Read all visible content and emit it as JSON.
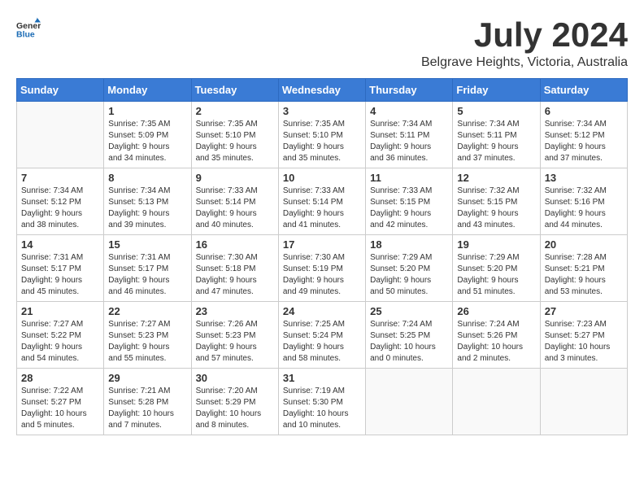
{
  "header": {
    "logo_general": "General",
    "logo_blue": "Blue",
    "month_title": "July 2024",
    "location": "Belgrave Heights, Victoria, Australia"
  },
  "days_of_week": [
    "Sunday",
    "Monday",
    "Tuesday",
    "Wednesday",
    "Thursday",
    "Friday",
    "Saturday"
  ],
  "weeks": [
    [
      {
        "day": "",
        "info": ""
      },
      {
        "day": "1",
        "info": "Sunrise: 7:35 AM\nSunset: 5:09 PM\nDaylight: 9 hours\nand 34 minutes."
      },
      {
        "day": "2",
        "info": "Sunrise: 7:35 AM\nSunset: 5:10 PM\nDaylight: 9 hours\nand 35 minutes."
      },
      {
        "day": "3",
        "info": "Sunrise: 7:35 AM\nSunset: 5:10 PM\nDaylight: 9 hours\nand 35 minutes."
      },
      {
        "day": "4",
        "info": "Sunrise: 7:34 AM\nSunset: 5:11 PM\nDaylight: 9 hours\nand 36 minutes."
      },
      {
        "day": "5",
        "info": "Sunrise: 7:34 AM\nSunset: 5:11 PM\nDaylight: 9 hours\nand 37 minutes."
      },
      {
        "day": "6",
        "info": "Sunrise: 7:34 AM\nSunset: 5:12 PM\nDaylight: 9 hours\nand 37 minutes."
      }
    ],
    [
      {
        "day": "7",
        "info": "Sunrise: 7:34 AM\nSunset: 5:12 PM\nDaylight: 9 hours\nand 38 minutes."
      },
      {
        "day": "8",
        "info": "Sunrise: 7:34 AM\nSunset: 5:13 PM\nDaylight: 9 hours\nand 39 minutes."
      },
      {
        "day": "9",
        "info": "Sunrise: 7:33 AM\nSunset: 5:14 PM\nDaylight: 9 hours\nand 40 minutes."
      },
      {
        "day": "10",
        "info": "Sunrise: 7:33 AM\nSunset: 5:14 PM\nDaylight: 9 hours\nand 41 minutes."
      },
      {
        "day": "11",
        "info": "Sunrise: 7:33 AM\nSunset: 5:15 PM\nDaylight: 9 hours\nand 42 minutes."
      },
      {
        "day": "12",
        "info": "Sunrise: 7:32 AM\nSunset: 5:15 PM\nDaylight: 9 hours\nand 43 minutes."
      },
      {
        "day": "13",
        "info": "Sunrise: 7:32 AM\nSunset: 5:16 PM\nDaylight: 9 hours\nand 44 minutes."
      }
    ],
    [
      {
        "day": "14",
        "info": "Sunrise: 7:31 AM\nSunset: 5:17 PM\nDaylight: 9 hours\nand 45 minutes."
      },
      {
        "day": "15",
        "info": "Sunrise: 7:31 AM\nSunset: 5:17 PM\nDaylight: 9 hours\nand 46 minutes."
      },
      {
        "day": "16",
        "info": "Sunrise: 7:30 AM\nSunset: 5:18 PM\nDaylight: 9 hours\nand 47 minutes."
      },
      {
        "day": "17",
        "info": "Sunrise: 7:30 AM\nSunset: 5:19 PM\nDaylight: 9 hours\nand 49 minutes."
      },
      {
        "day": "18",
        "info": "Sunrise: 7:29 AM\nSunset: 5:20 PM\nDaylight: 9 hours\nand 50 minutes."
      },
      {
        "day": "19",
        "info": "Sunrise: 7:29 AM\nSunset: 5:20 PM\nDaylight: 9 hours\nand 51 minutes."
      },
      {
        "day": "20",
        "info": "Sunrise: 7:28 AM\nSunset: 5:21 PM\nDaylight: 9 hours\nand 53 minutes."
      }
    ],
    [
      {
        "day": "21",
        "info": "Sunrise: 7:27 AM\nSunset: 5:22 PM\nDaylight: 9 hours\nand 54 minutes."
      },
      {
        "day": "22",
        "info": "Sunrise: 7:27 AM\nSunset: 5:23 PM\nDaylight: 9 hours\nand 55 minutes."
      },
      {
        "day": "23",
        "info": "Sunrise: 7:26 AM\nSunset: 5:23 PM\nDaylight: 9 hours\nand 57 minutes."
      },
      {
        "day": "24",
        "info": "Sunrise: 7:25 AM\nSunset: 5:24 PM\nDaylight: 9 hours\nand 58 minutes."
      },
      {
        "day": "25",
        "info": "Sunrise: 7:24 AM\nSunset: 5:25 PM\nDaylight: 10 hours\nand 0 minutes."
      },
      {
        "day": "26",
        "info": "Sunrise: 7:24 AM\nSunset: 5:26 PM\nDaylight: 10 hours\nand 2 minutes."
      },
      {
        "day": "27",
        "info": "Sunrise: 7:23 AM\nSunset: 5:27 PM\nDaylight: 10 hours\nand 3 minutes."
      }
    ],
    [
      {
        "day": "28",
        "info": "Sunrise: 7:22 AM\nSunset: 5:27 PM\nDaylight: 10 hours\nand 5 minutes."
      },
      {
        "day": "29",
        "info": "Sunrise: 7:21 AM\nSunset: 5:28 PM\nDaylight: 10 hours\nand 7 minutes."
      },
      {
        "day": "30",
        "info": "Sunrise: 7:20 AM\nSunset: 5:29 PM\nDaylight: 10 hours\nand 8 minutes."
      },
      {
        "day": "31",
        "info": "Sunrise: 7:19 AM\nSunset: 5:30 PM\nDaylight: 10 hours\nand 10 minutes."
      },
      {
        "day": "",
        "info": ""
      },
      {
        "day": "",
        "info": ""
      },
      {
        "day": "",
        "info": ""
      }
    ]
  ]
}
